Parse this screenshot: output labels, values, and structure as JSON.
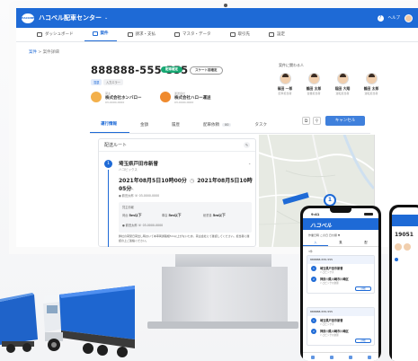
{
  "app": {
    "title": "ハコベル配車センター",
    "logo_text": "HACOBELL",
    "help_label": "ヘルプ",
    "chevron": "⌄"
  },
  "nav": [
    {
      "label": "ダッシュボード",
      "active": false
    },
    {
      "label": "案件",
      "active": true
    },
    {
      "label": "請求・支払",
      "active": false
    },
    {
      "label": "マスタ・データ",
      "active": false
    },
    {
      "label": "取引先",
      "active": false
    },
    {
      "label": "設定",
      "active": false
    }
  ],
  "breadcrumb": {
    "root": "案件",
    "separator": " > ",
    "current": "案件詳細"
  },
  "case": {
    "id": "888888-555-555",
    "status": "配車確定",
    "secondary_status": "スケート前確定",
    "tags": [
      "混載",
      "入力エラー"
    ]
  },
  "companies": [
    {
      "role": "荷主",
      "name": "株式会社ホンバロー",
      "tel": "03-0000-0000"
    },
    {
      "role": "運送会社",
      "name": "株式会社ハロー運送",
      "tel": "03-0000-0000"
    }
  ],
  "people": {
    "title": "案件に関わる人",
    "list": [
      {
        "name": "篠田 一郎",
        "role": "配車担当者"
      },
      {
        "name": "鶴田 太郎",
        "role": "営業担当者"
      },
      {
        "name": "稲田 大翔",
        "role": "運転担当者"
      },
      {
        "name": "鶴田 太郎",
        "role": "運転担当者"
      }
    ]
  },
  "tabs": [
    {
      "label": "運行情報",
      "active": true,
      "count": ""
    },
    {
      "label": "金額",
      "active": false,
      "count": ""
    },
    {
      "label": "履歴",
      "active": false,
      "count": ""
    },
    {
      "label": "配車依頼",
      "active": false,
      "count": "00"
    },
    {
      "label": "タスク",
      "active": false,
      "count": ""
    }
  ],
  "cancel_label": "キャンセル",
  "route": {
    "title": "配送ルート",
    "stop_number": "1",
    "stop_name": "埼玉県戸田市新曽",
    "stop_sub": "ハコビックス",
    "date_from": "2021年08月5日10時00分",
    "date_to": "2021年08月5日10時05分",
    "contact_label": "アイエム",
    "contact_name": "鶴田太郎",
    "contact_tel": "03-0000-0000",
    "info_title": "貸主情報",
    "info_rows": [
      {
        "k": "荷台",
        "v": "5m以下"
      },
      {
        "k": "車高",
        "v": "5m以下"
      },
      {
        "k": "総重量",
        "v": "5m以下"
      }
    ],
    "contact2_name": "鶴田太郎",
    "contact2_tel": "03-0000-0000",
    "description": "弊社の荷受日荷出し時おいて本車両通路幅5m以上がないため、荷主会社にて確認してください。担当者に確認の上ご連絡ください。"
  },
  "map": {
    "pin_number": "1"
  },
  "phone": {
    "time": "9:41",
    "logo": "ハコベル",
    "filter": "作業日時 この日 日付順 ▼",
    "tabs": [
      "入",
      "集",
      "配"
    ],
    "count": "3件",
    "cards": [
      {
        "id": "888888-555-555",
        "stops": [
          {
            "n": "1",
            "name": "埼玉県戸田市新曽",
            "sub": "ハコビックス"
          },
          {
            "n": "2",
            "name": "神奈川県川崎市川崎区",
            "sub": "ハコビックス倉庫"
          }
        ],
        "btn": "詳細"
      },
      {
        "id": "888888-555-555",
        "stops": [
          {
            "n": "1",
            "name": "埼玉県戸田市新曽",
            "sub": "ハコビックス"
          },
          {
            "n": "2",
            "name": "神奈川県川崎市川崎区",
            "sub": "ハコビックス倉庫"
          }
        ],
        "btn": "詳細"
      }
    ],
    "second_phone_text": "19051"
  },
  "colors": {
    "brand": "#1e6ad6",
    "green": "#18a974",
    "orange": "#ef8a2e"
  }
}
